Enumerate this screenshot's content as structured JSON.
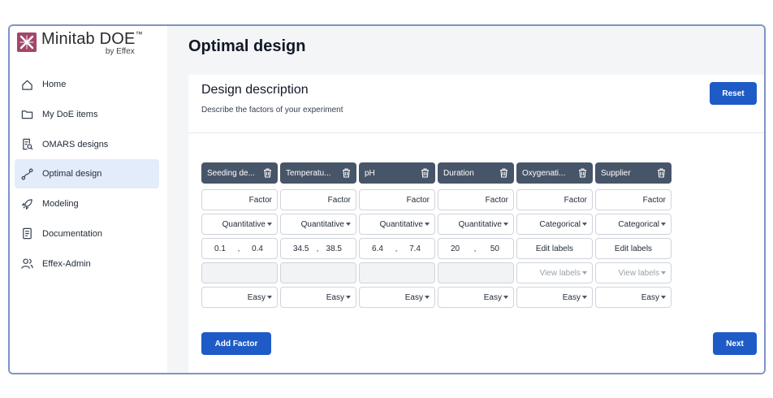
{
  "app": {
    "name": "Minitab DOE",
    "tm": "™",
    "subtitle": "by Effex"
  },
  "nav": [
    {
      "label": "Home",
      "icon": "home-icon"
    },
    {
      "label": "My DoE items",
      "icon": "folder-icon"
    },
    {
      "label": "OMARS designs",
      "icon": "document-search-icon"
    },
    {
      "label": "Optimal design",
      "icon": "design-path-icon",
      "active": true
    },
    {
      "label": "Modeling",
      "icon": "rocket-icon"
    },
    {
      "label": "Documentation",
      "icon": "document-icon"
    },
    {
      "label": "Effex-Admin",
      "icon": "users-icon"
    }
  ],
  "page": {
    "title": "Optimal design"
  },
  "card": {
    "title": "Design description",
    "subtitle": "Describe the factors of your experiment",
    "reset": "Reset",
    "add_factor": "Add Factor",
    "next": "Next"
  },
  "factors": [
    {
      "name": "Seeding de...",
      "label": "Factor",
      "type": "Quantitative",
      "low": "0.1",
      "high": "0.4",
      "difficulty": "Easy"
    },
    {
      "name": "Temperatu...",
      "label": "Factor",
      "type": "Quantitative",
      "low": "34.5",
      "high": "38.5",
      "difficulty": "Easy"
    },
    {
      "name": "pH",
      "label": "Factor",
      "type": "Quantitative",
      "low": "6.4",
      "high": "7.4",
      "difficulty": "Easy"
    },
    {
      "name": "Duration",
      "label": "Factor",
      "type": "Quantitative",
      "low": "20",
      "high": "50",
      "difficulty": "Easy"
    },
    {
      "name": "Oxygenati...",
      "label": "Factor",
      "type": "Categorical",
      "edit_labels": "Edit labels",
      "view_labels": "View labels",
      "difficulty": "Easy"
    },
    {
      "name": "Supplier",
      "label": "Factor",
      "type": "Categorical",
      "edit_labels": "Edit labels",
      "view_labels": "View labels",
      "difficulty": "Easy"
    }
  ],
  "range_separator": ",",
  "colors": {
    "primary": "#1e5bc6",
    "header": "#475569",
    "active_nav": "#e3ecfa",
    "logo": "#a2476a"
  }
}
